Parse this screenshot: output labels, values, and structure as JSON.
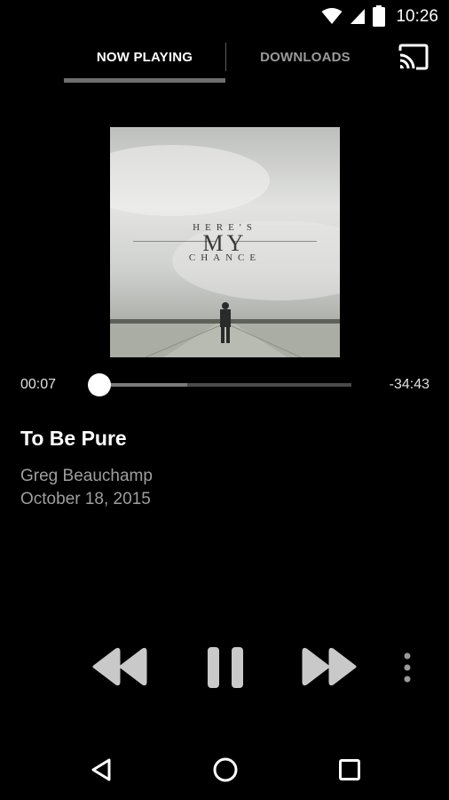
{
  "status_bar": {
    "time": "10:26",
    "icons": [
      "wifi-icon",
      "cell-signal-icon",
      "battery-icon"
    ]
  },
  "tabs": [
    {
      "label": "NOW PLAYING",
      "active": true
    },
    {
      "label": "DOWNLOADS",
      "active": false
    }
  ],
  "cast_icon": "cast-icon",
  "album_art": {
    "line1": "HERE'S",
    "line2": "MY",
    "line3": "CHANCE"
  },
  "player": {
    "elapsed": "00:07",
    "remaining": "-34:43",
    "progress": 0.0,
    "buffered": 0.35
  },
  "track": {
    "title": "To Be Pure",
    "artist": "Greg Beauchamp",
    "date": "October 18, 2015"
  },
  "controls": [
    "rewind-icon",
    "pause-icon",
    "fast-forward-icon",
    "more-vert-icon"
  ],
  "navigation": [
    "back-icon",
    "home-icon",
    "recents-icon"
  ],
  "colors": {
    "background": "#000000",
    "inactive_text": "#9a9a9a",
    "secondary_text": "#9e9e9e"
  }
}
